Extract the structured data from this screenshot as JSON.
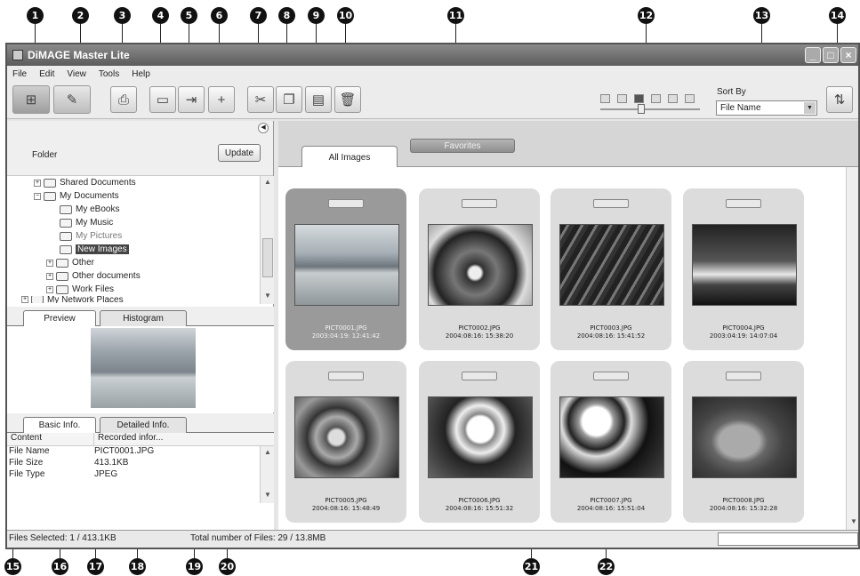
{
  "callouts": [
    "1",
    "2",
    "3",
    "4",
    "5",
    "6",
    "7",
    "8",
    "9",
    "10",
    "11",
    "12",
    "13",
    "14",
    "15",
    "16",
    "17",
    "18",
    "19",
    "20",
    "21",
    "22"
  ],
  "window": {
    "title": "DiMAGE Master Lite",
    "controls": {
      "minimize": "_",
      "maximize": "□",
      "close": "×"
    }
  },
  "menu": [
    "File",
    "Edit",
    "View",
    "Tools",
    "Help"
  ],
  "toolbar": {
    "view_grid_icon": "grid-view-icon",
    "view_edit_icon": "edit-mode-icon",
    "print_icon": "print-icon",
    "sort_label": "Sort By",
    "sort_value": "File Name"
  },
  "folder_panel": {
    "label": "Folder",
    "update_button": "Update",
    "tree": [
      {
        "label": "Shared Documents",
        "toggle": "+"
      },
      {
        "label": "My Documents",
        "toggle": "−"
      },
      {
        "label": "My eBooks",
        "toggle": ""
      },
      {
        "label": "My Music",
        "toggle": ""
      },
      {
        "label": "My Pictures",
        "toggle": ""
      },
      {
        "label": "New Images",
        "toggle": ""
      },
      {
        "label": "Other",
        "toggle": "+"
      },
      {
        "label": "Other documents",
        "toggle": "+"
      },
      {
        "label": "Work Files",
        "toggle": "+"
      },
      {
        "label": "My Network Places",
        "toggle": "+"
      }
    ]
  },
  "preview_tabs": {
    "preview": "Preview",
    "histogram": "Histogram"
  },
  "info_tabs": {
    "basic": "Basic Info.",
    "detailed": "Detailed Info."
  },
  "info_table": {
    "headers": [
      "Content",
      "Recorded infor..."
    ],
    "rows": [
      [
        "File Name",
        "PICT0001.JPG"
      ],
      [
        "File Size",
        "413.1KB"
      ],
      [
        "File Type",
        "JPEG"
      ]
    ]
  },
  "image_tabs": {
    "all": "All Images",
    "favorites": "Favorites"
  },
  "thumbnails": [
    {
      "name": "PICT0001.JPG",
      "date": "2003:04:19: 12:41:42"
    },
    {
      "name": "PICT0002.JPG",
      "date": "2004:08:16: 15:38:20"
    },
    {
      "name": "PICT0003.JPG",
      "date": "2004:08:16: 15:41:52"
    },
    {
      "name": "PICT0004.JPG",
      "date": "2003:04:19: 14:07:04"
    },
    {
      "name": "PICT0005.JPG",
      "date": "2004:08:16: 15:48:49"
    },
    {
      "name": "PICT0006.JPG",
      "date": "2004:08:16: 15:51:32"
    },
    {
      "name": "PICT0007.JPG",
      "date": "2004:08:16: 15:51:04"
    },
    {
      "name": "PICT0008.JPG",
      "date": "2004:08:16: 15:32:28"
    }
  ],
  "status": {
    "selected": "Files Selected: 1 / 413.1KB",
    "total": "Total number of Files: 29 / 13.8MB"
  }
}
